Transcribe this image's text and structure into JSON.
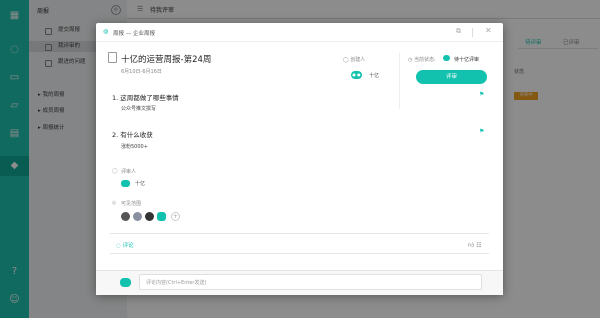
{
  "sidebar": {
    "header": "周报",
    "items": [
      {
        "label": "提交周报",
        "selected": false
      },
      {
        "label": "我评审的",
        "selected": true
      },
      {
        "label": "跟进的问题",
        "selected": false
      }
    ],
    "groups": [
      "我的周报",
      "成员周报",
      "周报统计"
    ]
  },
  "main": {
    "title": "待我评审",
    "tabs": [
      "待评审",
      "已评审"
    ],
    "column_state": "状态",
    "state_badge": "评审中"
  },
  "modal": {
    "breadcrumb": "周报 — 企业周报",
    "report_title": "十亿的运营周报-第24周",
    "date_range": "6月10日-6月16日",
    "creator_label": "创建人",
    "creator_name": "十亿",
    "status_label": "当前状态:",
    "status_value": "待十亿评审",
    "review_button": "评审",
    "questions": [
      {
        "q": "1. 这周都做了哪些事情",
        "a": "公众号推文撰写"
      },
      {
        "q": "2. 有什么收获",
        "a": "涨粉5000+"
      }
    ],
    "reviewer_label": "评审人",
    "reviewer_name": "十亿",
    "visible_label": "可见范围",
    "comment_tab": "评论",
    "comment_placeholder": "评论内容(Ctrl+Enter发送)"
  },
  "colors": {
    "accent": "#13c2ae",
    "rail": "#1fc1ae",
    "badge": "#f0a020"
  }
}
